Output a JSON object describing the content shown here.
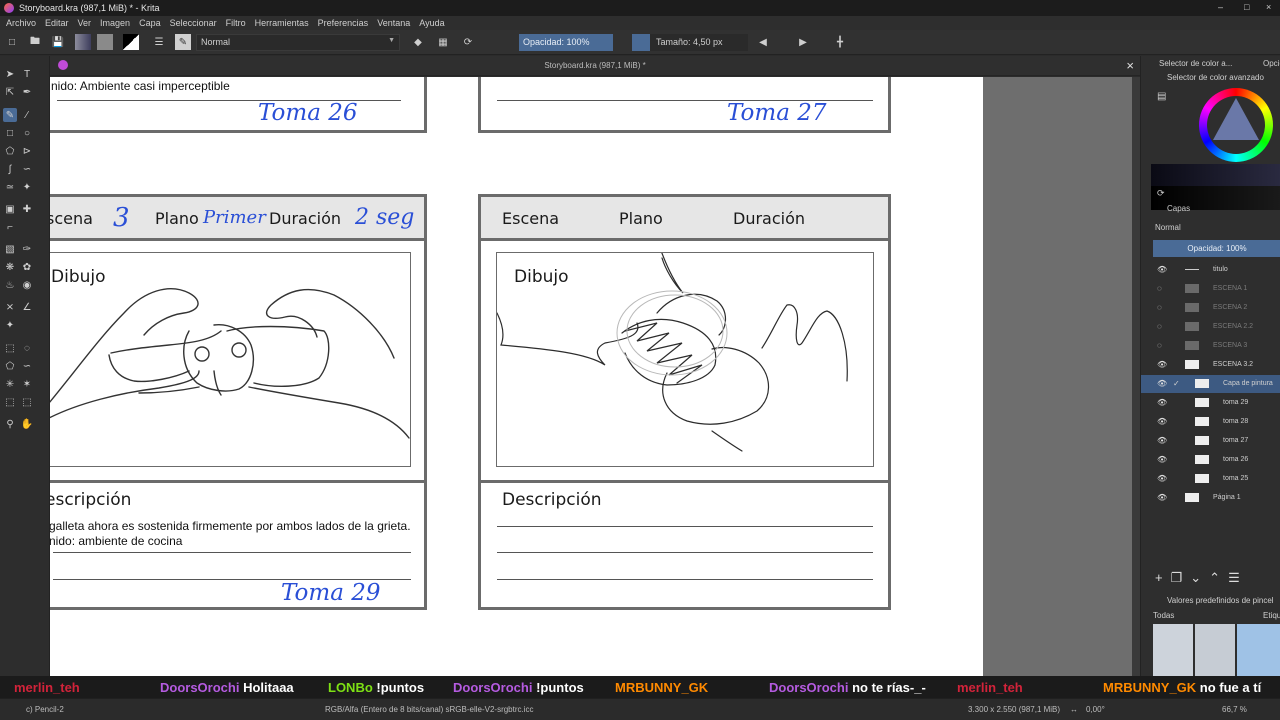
{
  "window": {
    "title": "Storyboard.kra (987,1 MiB) * - Krita",
    "controls": [
      "–",
      "□",
      "×"
    ]
  },
  "menu": [
    "Archivo",
    "Editar",
    "Ver",
    "Imagen",
    "Capa",
    "Seleccionar",
    "Filtro",
    "Herramientas",
    "Preferencias",
    "Ventana",
    "Ayuda"
  ],
  "toolbar": {
    "blend_mode": "Normal",
    "opacity": "Opacidad: 100%",
    "size": "Tamaño: 4,50 px"
  },
  "document_tab": {
    "title": "Storyboard.kra (987,1 MiB) *",
    "close": "×"
  },
  "storyboard": {
    "top_left": {
      "description_text": "nido: Ambiente casi imperceptible",
      "shot": "Toma 26"
    },
    "top_right": {
      "shot": "Toma 27"
    },
    "bottom_left": {
      "escena_label": "scena",
      "escena_value": "3",
      "plano_label": "Plano",
      "plano_value": "Primer",
      "duracion_label": "Duración",
      "duracion_value": "2 seg",
      "dibujo_label": "Dibujo",
      "descripcion_label": "escripción",
      "description_line1": "galleta ahora es sostenida firmemente por ambos lados de la grieta.",
      "description_line2": "nido: ambiente de cocina",
      "shot": "Toma 29"
    },
    "bottom_right": {
      "escena_label": "Escena",
      "plano_label": "Plano",
      "duracion_label": "Duración",
      "dibujo_label": "Dibujo",
      "descripcion_label": "Descripción"
    }
  },
  "right_panel": {
    "tabs": [
      "Selector de color a...",
      "Opcione"
    ],
    "color_selector_title": "Selector de color avanzado",
    "layers_title": "Capas",
    "layers_blend": "Normal",
    "layers_opacity": "Opacidad:  100%",
    "layers": [
      {
        "name": "titulo",
        "visible": true
      },
      {
        "name": "ESCENA 1",
        "visible": false
      },
      {
        "name": "ESCENA 2",
        "visible": false
      },
      {
        "name": "ESCENA 2.2",
        "visible": false
      },
      {
        "name": "ESCENA 3",
        "visible": false
      },
      {
        "name": "ESCENA 3.2",
        "visible": true
      },
      {
        "name": "Capa de pintura",
        "visible": true,
        "selected": true
      },
      {
        "name": "toma 29",
        "visible": true
      },
      {
        "name": "toma 28",
        "visible": true
      },
      {
        "name": "toma 27",
        "visible": true
      },
      {
        "name": "toma 26",
        "visible": true
      },
      {
        "name": "toma 25",
        "visible": true
      },
      {
        "name": "Página 1",
        "visible": true
      }
    ],
    "brush_presets_title": "Valores predefinidos de pincel",
    "brush_filter": "Todas",
    "brush_tag": "Etique"
  },
  "chat": [
    {
      "user": "merlin_teh",
      "color": "#d2233a",
      "message": ""
    },
    {
      "user": "DoorsOrochi",
      "color": "#b55be0",
      "message": "Holitaaa"
    },
    {
      "user": "LONBo",
      "color": "#7de014",
      "message": "!puntos"
    },
    {
      "user": "DoorsOrochi",
      "color": "#b55be0",
      "message": "!puntos"
    },
    {
      "user": "MRBUNNY_GK",
      "color": "#ff8a00",
      "message": ""
    },
    {
      "user": "DoorsOrochi",
      "color": "#b55be0",
      "message": "no te rías-_-"
    },
    {
      "user": "merlin_teh",
      "color": "#d2233a",
      "message": ""
    },
    {
      "user": "MRBUNNY_GK",
      "color": "#ff8a00",
      "message": "no fue a tí"
    }
  ],
  "status": {
    "brush": "c) Pencil-2",
    "colorspace": "RGB/Alfa (Entero de 8 bits/canal)  sRGB-elle-V2-srgbtrc.icc",
    "dimensions": "3.300 x 2.550 (987,1 MiB)",
    "rotation": "0,00°",
    "zoom": "66,7 %"
  }
}
